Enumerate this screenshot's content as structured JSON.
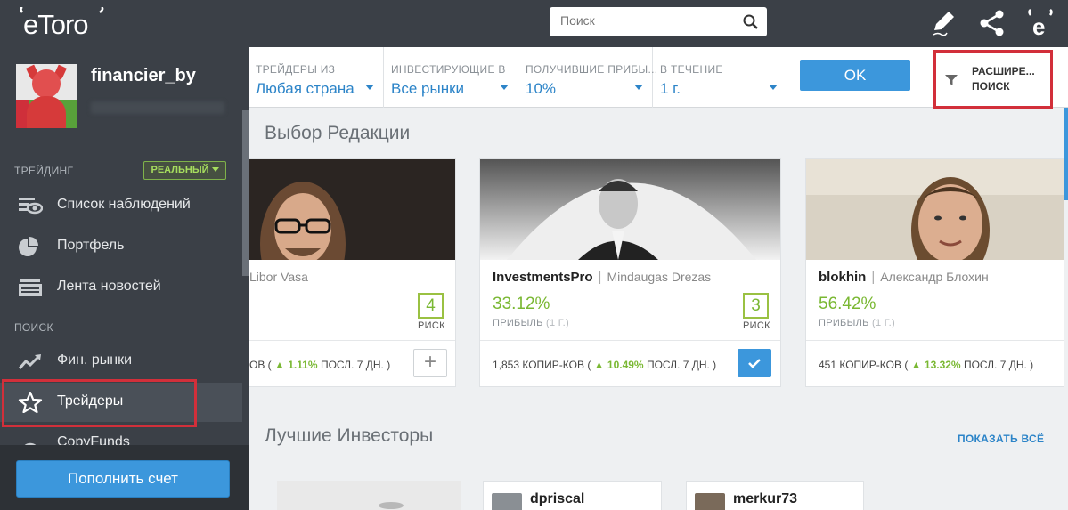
{
  "brand": {
    "logo": "eToro"
  },
  "profile": {
    "username": "financier_by"
  },
  "sidebar": {
    "trading_label": "ТРЕЙДИНГ",
    "account_badge": "РЕАЛЬНЫЙ",
    "trading_items": [
      {
        "label": "Список наблюдений",
        "icon": "eye-list-icon"
      },
      {
        "label": "Портфель",
        "icon": "pie-chart-icon"
      },
      {
        "label": "Лента новостей",
        "icon": "news-feed-icon"
      }
    ],
    "search_label": "ПОИСК",
    "search_items": [
      {
        "label": "Фин. рынки",
        "icon": "trend-chart-icon"
      },
      {
        "label": "Трейдеры",
        "icon": "star-icon",
        "active": true
      },
      {
        "label": "CopyFunds",
        "icon": "copyfunds-icon"
      }
    ],
    "deposit_button": "Пополнить счет"
  },
  "topbar": {
    "search_placeholder": "Поиск",
    "icons": [
      "edit-pen-icon",
      "share-icon",
      "etoro-e-icon"
    ]
  },
  "filters": [
    {
      "title": "ТРЕЙДЕРЫ ИЗ",
      "value": "Любая страна"
    },
    {
      "title": "ИНВЕСТИРУЮЩИЕ В",
      "value": "Все рынки"
    },
    {
      "title": "ПОЛУЧИВШИЕ ПРИБЫ...",
      "value": "10%"
    },
    {
      "title": "В ТЕЧЕНИЕ",
      "value": "1 г."
    }
  ],
  "ok_button": "OK",
  "advanced_search": {
    "line1": "РАСШИРЕ...",
    "line2": "ПОИСК"
  },
  "editors_choice": {
    "title": "Выбор Редакции",
    "cards": [
      {
        "username": "",
        "real_name": "Libor Vasa",
        "gain": "",
        "gain_label": "",
        "gain_period": "",
        "risk": "4",
        "risk_label": "РИСК",
        "copiers_text": "ОВ (",
        "weekly_change": "1.11%",
        "weekly_label": "ПОСЛ. 7 ДН. )",
        "action": "plus"
      },
      {
        "username": "InvestmentsPro",
        "real_name": "Mindaugas Drezas",
        "gain": "33.12%",
        "gain_label": "ПРИБЫЛЬ",
        "gain_period": "(1 Г.)",
        "risk": "3",
        "risk_label": "РИСК",
        "copiers_text": "1,853 КОПИР-КОВ (",
        "weekly_change": "10.49%",
        "weekly_label": "ПОСЛ. 7 ДН. )",
        "action": "check"
      },
      {
        "username": "blokhin",
        "real_name": "Александр Блохин",
        "gain": "56.42%",
        "gain_label": "ПРИБЫЛЬ",
        "gain_period": "(1 Г.)",
        "risk": "",
        "risk_label": "",
        "copiers_text": "451 КОПИР-КОВ (",
        "weekly_change": "13.32%",
        "weekly_label": "ПОСЛ. 7 ДН. )",
        "action": "none"
      }
    ]
  },
  "best_investors": {
    "title": "Лучшие Инвесторы",
    "show_all": "ПОКАЗАТЬ ВСЁ",
    "items": [
      {
        "username": "dpriscal"
      },
      {
        "username": "merkur73"
      }
    ]
  },
  "colors": {
    "sidebar_bg": "#3b4047",
    "accent_blue": "#3c97dc",
    "gain_green": "#7ab833",
    "highlight_red": "#d22f3a"
  }
}
